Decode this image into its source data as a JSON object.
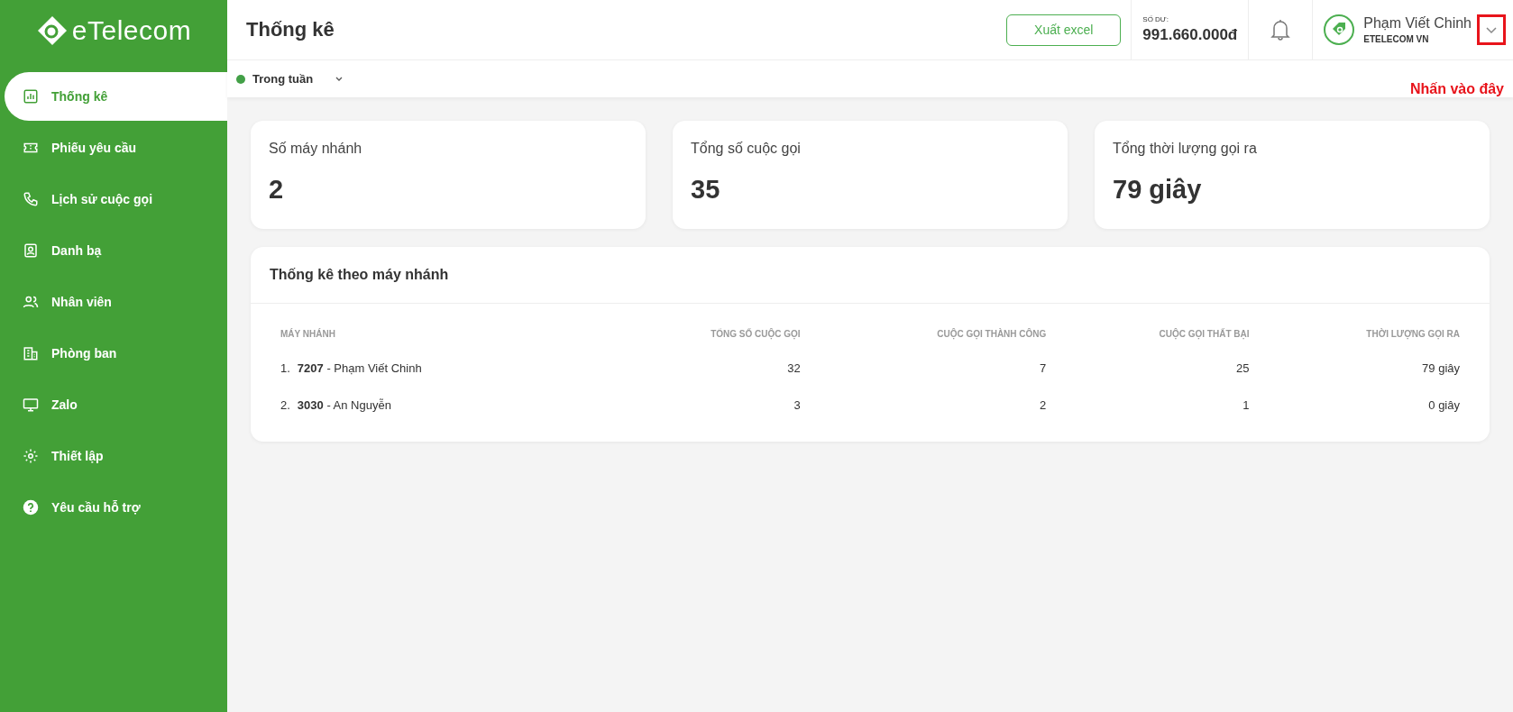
{
  "sidebar": {
    "logo": "eTelecom",
    "items": [
      {
        "label": "Thống kê",
        "kind": "chart",
        "selected": true
      },
      {
        "label": "Phiếu yêu cầu",
        "kind": "ticket",
        "selected": false
      },
      {
        "label": "Lịch sử cuộc gọi",
        "kind": "phone",
        "selected": false
      },
      {
        "label": "Danh bạ",
        "kind": "contact",
        "selected": false
      },
      {
        "label": "Nhân viên",
        "kind": "people",
        "selected": false
      },
      {
        "label": "Phòng ban",
        "kind": "building",
        "selected": false
      },
      {
        "label": "Zalo",
        "kind": "monitor",
        "selected": false
      },
      {
        "label": "Thiết lập",
        "kind": "gear",
        "selected": false
      },
      {
        "label": "Yêu cầu hỗ trợ",
        "kind": "help",
        "selected": false
      }
    ]
  },
  "header": {
    "title": "Thống kê",
    "export_button": "Xuất excel",
    "balance": {
      "label": "SỐ DƯ:",
      "value": "991.660.000đ"
    },
    "user": {
      "name": "Phạm Viết Chinh",
      "company": "ETELECOM VN"
    },
    "annotation": "Nhấn vào đây"
  },
  "filter": {
    "label": "Trong tuần",
    "color": "#43a047"
  },
  "stats": [
    {
      "label": "Số máy nhánh",
      "value": "2"
    },
    {
      "label": "Tổng số cuộc gọi",
      "value": "35"
    },
    {
      "label": "Tổng thời lượng gọi ra",
      "value": "79 giây"
    }
  ],
  "table": {
    "title": "Thống kê theo máy nhánh",
    "columns": [
      "MÁY NHÁNH",
      "TỔNG SỐ CUỘC GỌI",
      "CUỘC GỌI THÀNH CÔNG",
      "CUỘC GỌI THẤT BẠI",
      "THỜI LƯỢNG GỌI RA"
    ],
    "rows": [
      {
        "index": "1.",
        "extension": "**7207** - Phạm Viết Chinh",
        "total": "32",
        "success": "7",
        "failed": "25",
        "duration": "79 giây"
      },
      {
        "index": "2.",
        "extension": "**3030** - An Nguyễn",
        "total": "3",
        "success": "2",
        "failed": "1",
        "duration": "0 giây"
      }
    ]
  }
}
